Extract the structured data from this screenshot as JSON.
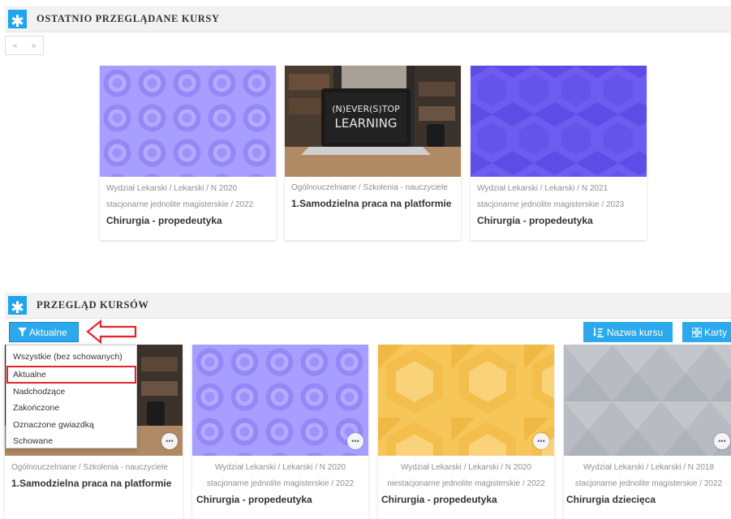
{
  "recent": {
    "title": "OSTATNIO PRZEGLĄDANE KURSY",
    "pager": {
      "prev": "«",
      "next": "»"
    },
    "cards": [
      {
        "meta1": "Wydział Lekarski / Lekarski / N 2020",
        "meta2": "stacjonarne jednolite magisterskie / 2022",
        "name": "Chirurgia - propedeutyka"
      },
      {
        "meta1": "Ogólnouczelniane / Szkolenia - nauczyciele",
        "name": "1.Samodzielna praca na platformie",
        "image_text1": "(N)EVER(S)TOP",
        "image_text2": "LEARNING"
      },
      {
        "meta1": "Wydział Lekarski / Lekarski / N 2021",
        "meta2": "stacjonarne jednolite magisterskie / 2023",
        "name": "Chirurgia - propedeutyka"
      }
    ]
  },
  "overview": {
    "title": "PRZEGLĄD KURSÓW",
    "filter_label": "Aktualne",
    "sort_label": "Nazwa kursu",
    "view_label": "Karty",
    "dropdown": [
      "Wszystkie (bez schowanych)",
      "Aktualne",
      "Nadchodzące",
      "Zakończone",
      "Oznaczone gwiazdką",
      "Schowane"
    ],
    "cards": [
      {
        "meta1": "Ogólnouczelniane / Szkolenia - nauczyciele",
        "name": "1.Samodzielna praca na platformie"
      },
      {
        "meta1": "Wydział Lekarski / Lekarski / N 2020",
        "meta2": "stacjonarne jednolite magisterskie / 2022",
        "name": "Chirurgia - propedeutyka"
      },
      {
        "meta1": "Wydział Lekarski / Lekarski / N 2020",
        "meta2": "niestacjonarne jednolite magisterskie / 2022",
        "name": "Chirurgia - propedeutyka"
      },
      {
        "meta1": "Wydział Lekarski / Lekarski / N 2018",
        "meta2": "stacjonarne jednolite magisterskie / 2022",
        "name": "Chirurgia dziecięca"
      }
    ],
    "more_icon": "ellipsis-icon"
  },
  "colors": {
    "accent": "#2ba9ec",
    "highlight": "#e0262d",
    "purple_pattern": "#9e95ff",
    "indigo_pattern": "#6350e8",
    "yellow_pattern": "#f6c85f",
    "gray_pattern": "#b9bec4"
  }
}
